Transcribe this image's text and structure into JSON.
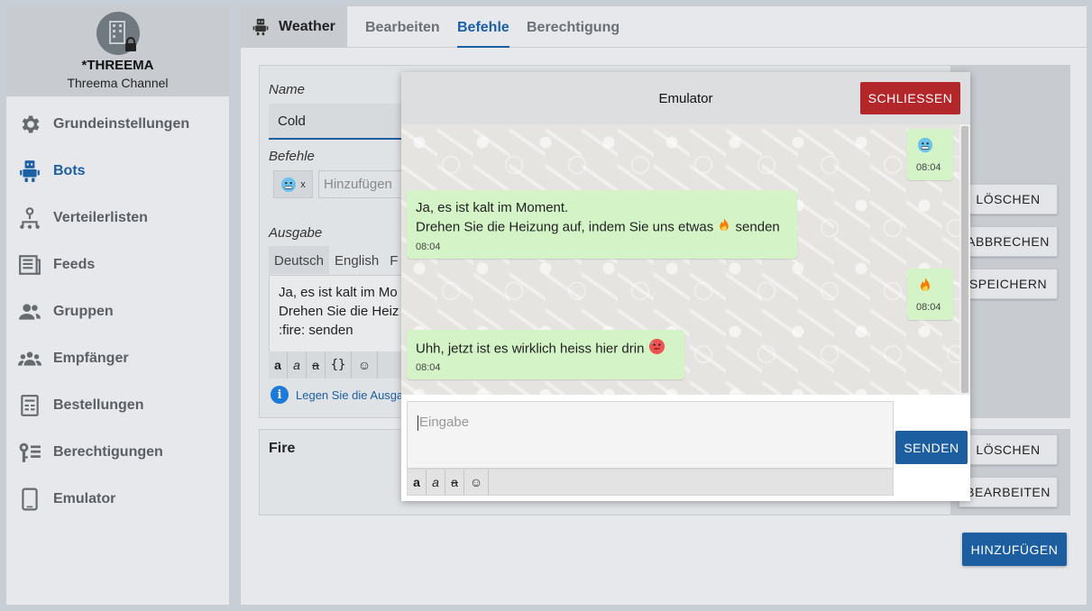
{
  "sidebar": {
    "channel_name": "*THREEMA",
    "channel_sub": "Threema Channel",
    "items": [
      {
        "label": "Grundeinstellungen",
        "icon": "gear-icon"
      },
      {
        "label": "Bots",
        "icon": "robot-icon"
      },
      {
        "label": "Verteilerlisten",
        "icon": "distribution-icon"
      },
      {
        "label": "Feeds",
        "icon": "feed-icon"
      },
      {
        "label": "Gruppen",
        "icon": "group-icon"
      },
      {
        "label": "Empfänger",
        "icon": "recipients-icon"
      },
      {
        "label": "Bestellungen",
        "icon": "orders-icon"
      },
      {
        "label": "Berechtigungen",
        "icon": "key-icon"
      },
      {
        "label": "Emulator",
        "icon": "phone-icon"
      }
    ],
    "active_index": 1
  },
  "tabs": {
    "bot_name": "Weather",
    "items": [
      "Bearbeiten",
      "Befehle",
      "Berechtigung"
    ],
    "active": "Befehle"
  },
  "command_form": {
    "name_label": "Name",
    "name_value": "Cold",
    "commands_label": "Befehle",
    "chip_remove": "x",
    "add_placeholder": "Hinzufügen",
    "output_label": "Ausgabe",
    "languages": [
      "Deutsch",
      "English",
      "F"
    ],
    "output_text": "Ja, es ist kalt im Mo\nDrehen Sie die Heiz\n:fire: senden",
    "format_buttons": [
      "a",
      "a",
      "a",
      "{}",
      "☺"
    ],
    "hint_icon": "i",
    "hint": "Legen Sie die Ausga"
  },
  "side_buttons": {
    "delete": "LÖSCHEN",
    "cancel": "ABBRECHEN",
    "save": "SPEICHERN",
    "delete2": "LÖSCHEN",
    "edit": "BEARBEITEN"
  },
  "fire_card": {
    "title": "Fire"
  },
  "add_button": "HINZUFÜGEN",
  "emulator": {
    "title": "Emulator",
    "close": "SCHLIESSEN",
    "messages": [
      {
        "sender": "user",
        "time": "08:04"
      },
      {
        "sender": "bot",
        "line1": "Ja, es ist kalt im Moment.",
        "line2a": "Drehen Sie die Heizung auf, indem Sie uns etwas",
        "line2b": "senden",
        "time": "08:04"
      },
      {
        "sender": "user",
        "time": "08:04"
      },
      {
        "sender": "bot",
        "text": "Uhh, jetzt ist es wirklich heiss hier drin",
        "time": "08:04"
      }
    ],
    "input_placeholder": "Eingabe",
    "format_buttons": [
      "a",
      "a",
      "a",
      "☺"
    ],
    "send": "SENDEN"
  },
  "colors": {
    "accent": "#1c5fa3",
    "close_red": "#b3262a",
    "bubble_green": "#d4f4c8"
  }
}
